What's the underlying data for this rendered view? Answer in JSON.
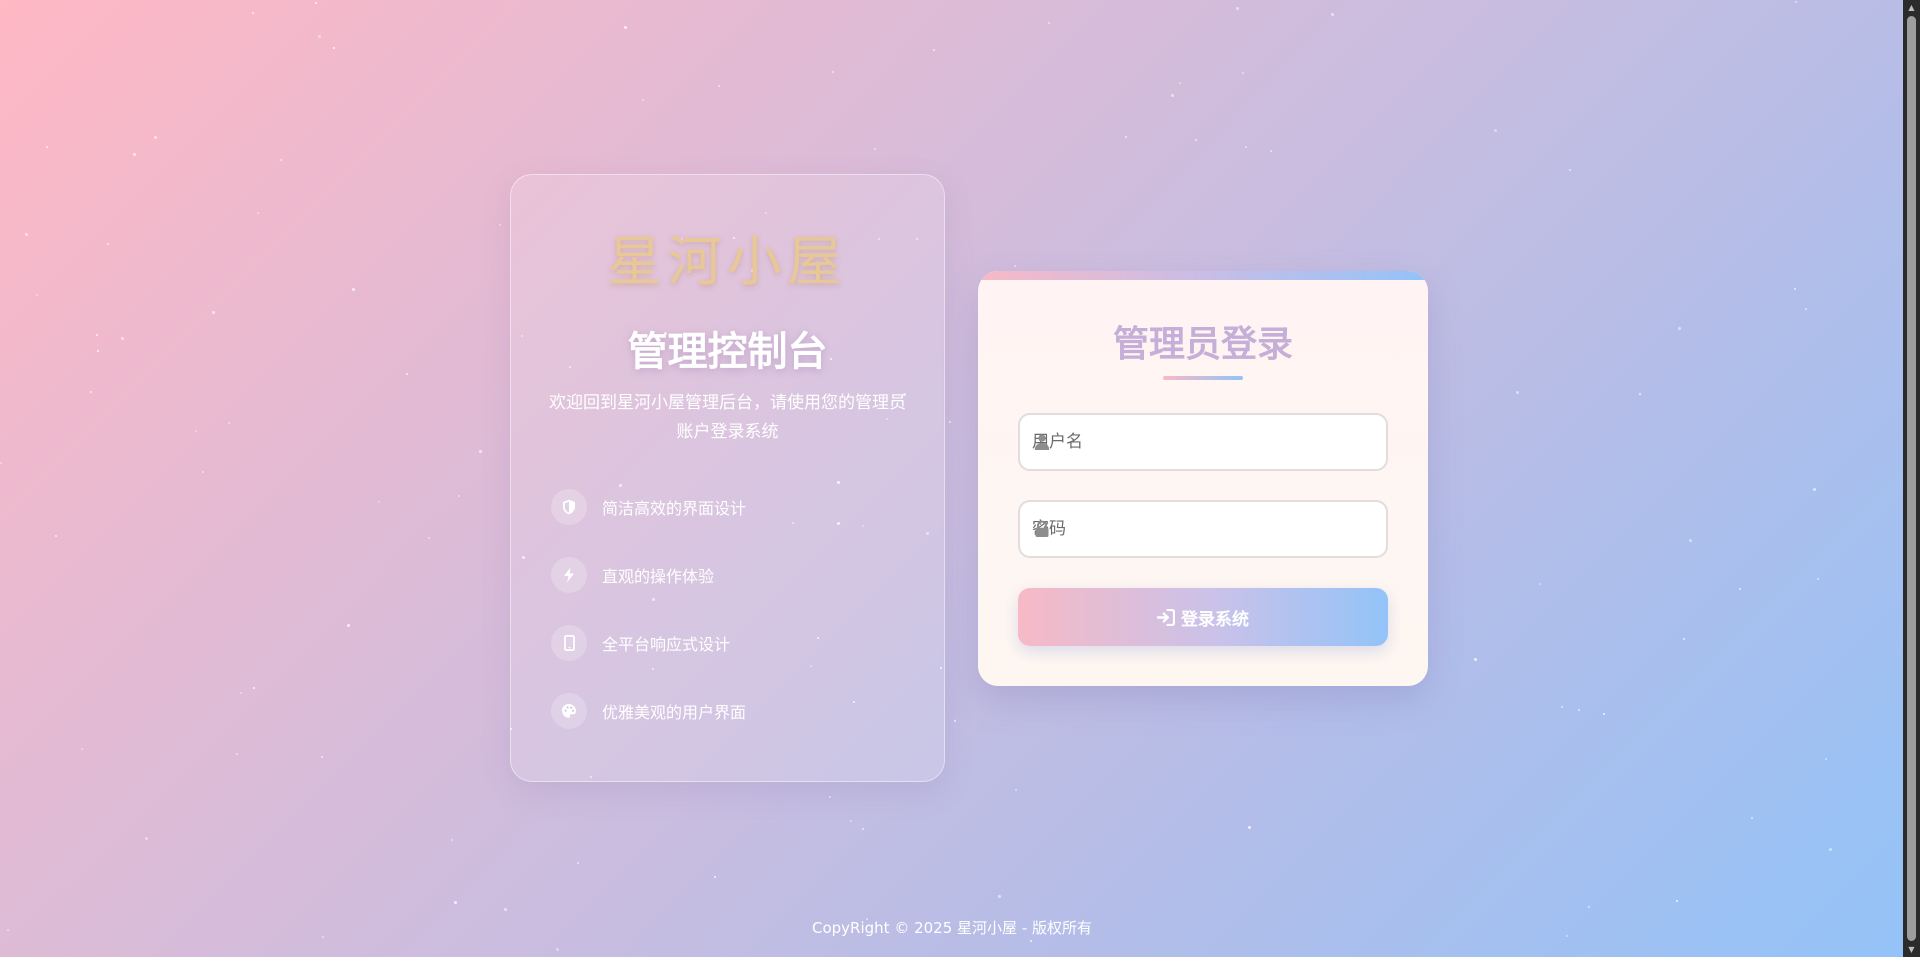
{
  "brand": {
    "name": "星河小屋"
  },
  "info": {
    "title": "管理控制台",
    "description": "欢迎回到星河小屋管理后台，请使用您的管理员账户登录系统",
    "features": [
      {
        "icon": "shield-icon",
        "label": "简洁高效的界面设计"
      },
      {
        "icon": "lightning-icon",
        "label": "直观的操作体验"
      },
      {
        "icon": "mobile-icon",
        "label": "全平台响应式设计"
      },
      {
        "icon": "palette-icon",
        "label": "优雅美观的用户界面"
      }
    ]
  },
  "login": {
    "title": "管理员登录",
    "username_placeholder": "用户名",
    "password_placeholder": "密码",
    "submit_label": "登录系统",
    "username_icon": "user-icon",
    "password_icon": "lock-icon",
    "submit_icon": "sign-in-icon"
  },
  "footer": {
    "copyright": "CopyRight © 2025 星河小屋 - 版权所有"
  },
  "colors": {
    "brand_gold": "#e8c896",
    "login_title": "#c5aed7",
    "accent_pink": "#f7b9c6",
    "accent_blue": "#93c3f8"
  }
}
